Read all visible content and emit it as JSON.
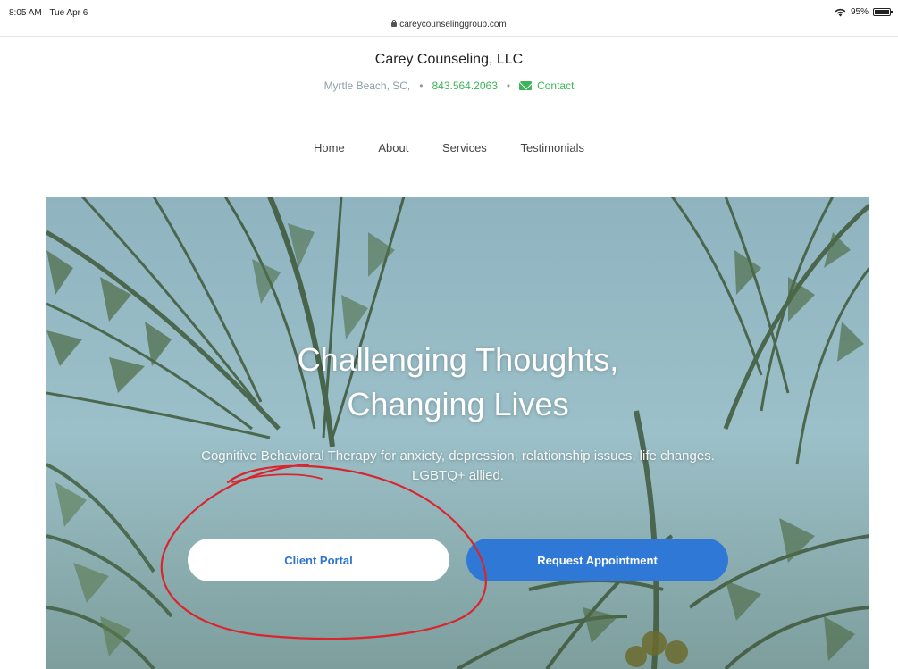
{
  "status_bar": {
    "time": "8:05 AM",
    "date": "Tue Apr 6",
    "battery": "95%"
  },
  "browser": {
    "url": "careycounselinggroup.com"
  },
  "header": {
    "title": "Carey Counseling, LLC",
    "location": "Myrtle Beach, SC,",
    "phone": "843.564.2063",
    "contact_label": "Contact"
  },
  "nav": {
    "items": [
      "Home",
      "About",
      "Services",
      "Testimonials"
    ]
  },
  "hero": {
    "title_line1": "Challenging Thoughts,",
    "title_line2": "Changing Lives",
    "subtitle": "Cognitive Behavioral Therapy for anxiety, depression, relationship issues, life changes. LGBTQ+ allied.",
    "portal_label": "Client Portal",
    "appointment_label": "Request Appointment"
  },
  "colors": {
    "accent_green": "#3cb55a",
    "button_blue": "#2f78d6",
    "annotation_red": "#d8262e"
  },
  "icons": {
    "wifi": "wifi-icon",
    "battery": "battery-icon",
    "lock": "lock-icon",
    "mail": "mail-icon"
  }
}
